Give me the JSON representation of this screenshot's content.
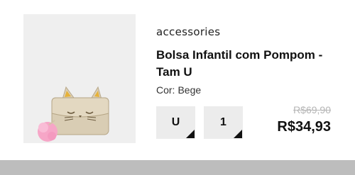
{
  "product": {
    "brand": "accessories",
    "title": "Bolsa Infantil com Pompom - Tam U",
    "color_label": "Cor:",
    "color_value": "Bege",
    "size_value": "U",
    "quantity_value": "1",
    "old_price": "R$69,90",
    "price": "R$34,93",
    "image_icon": "cat-handbag-with-pompom-image"
  },
  "colors": {
    "bag": "#d9cdb4",
    "pompom": "#f6a6c7",
    "image_bg": "#efefef",
    "bottom_bar": "#bdbdbd"
  }
}
